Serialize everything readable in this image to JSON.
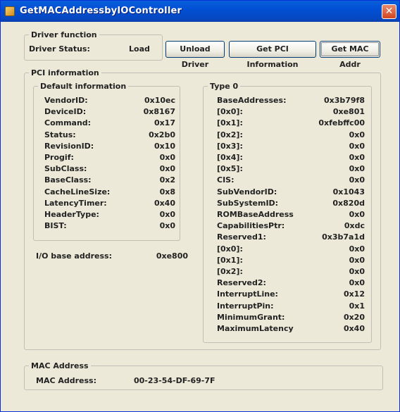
{
  "window": {
    "title": "GetMACAddressbyIOController",
    "close_glyph": "✕"
  },
  "driver": {
    "legend": "Driver function",
    "status_label": "Driver Status:",
    "status_value": "Load",
    "unload_button": "Unload Driver",
    "pci_button": "Get PCI Information",
    "mac_button": "Get MAC Addr"
  },
  "pci": {
    "legend": "PCI information",
    "default": {
      "legend": "Default information",
      "rows": [
        {
          "label": "VendorID:",
          "value": "0x10ec"
        },
        {
          "label": "DeviceID:",
          "value": "0x8167"
        },
        {
          "label": "Command:",
          "value": "0x17"
        },
        {
          "label": "Status:",
          "value": "0x2b0"
        },
        {
          "label": "RevisionID:",
          "value": "0x10"
        },
        {
          "label": "Progif:",
          "value": "0x0"
        },
        {
          "label": "SubClass:",
          "value": "0x0"
        },
        {
          "label": "BaseClass:",
          "value": "0x2"
        },
        {
          "label": "CacheLineSize:",
          "value": "0x8"
        },
        {
          "label": "LatencyTimer:",
          "value": "0x40"
        },
        {
          "label": "HeaderType:",
          "value": "0x0"
        },
        {
          "label": "BIST:",
          "value": "0x0"
        }
      ]
    },
    "io_label": "I/O base address:",
    "io_value": "0xe800",
    "type0": {
      "legend": "Type 0",
      "rows": [
        {
          "label": "BaseAddresses:",
          "value": "0x3b79f8"
        },
        {
          "label": "[0x0]:",
          "value": "0xe801"
        },
        {
          "label": "[0x1]:",
          "value": "0xfebffc00"
        },
        {
          "label": "[0x2]:",
          "value": "0x0"
        },
        {
          "label": "[0x3]:",
          "value": "0x0"
        },
        {
          "label": "[0x4]:",
          "value": "0x0"
        },
        {
          "label": "[0x5]:",
          "value": "0x0"
        },
        {
          "label": "CIS:",
          "value": "0x0"
        },
        {
          "label": "SubVendorID:",
          "value": "0x1043"
        },
        {
          "label": "SubSystemID:",
          "value": "0x820d"
        },
        {
          "label": "ROMBaseAddress",
          "value": "0x0"
        },
        {
          "label": "CapabilitiesPtr:",
          "value": "0xdc"
        },
        {
          "label": "Reserved1:",
          "value": "0x3b7a1d"
        },
        {
          "label": "[0x0]:",
          "value": "0x0"
        },
        {
          "label": "[0x1]:",
          "value": "0x0"
        },
        {
          "label": "[0x2]:",
          "value": "0x0"
        },
        {
          "label": "Reserved2:",
          "value": "0x0"
        },
        {
          "label": "InterruptLine:",
          "value": "0x12"
        },
        {
          "label": "InterruptPin:",
          "value": "0x1"
        },
        {
          "label": "MinimumGrant:",
          "value": "0x20"
        },
        {
          "label": "MaximumLatency",
          "value": "0x40"
        }
      ]
    }
  },
  "mac": {
    "legend": "MAC Address",
    "label": "MAC Address:",
    "value": "00-23-54-DF-69-7F"
  }
}
